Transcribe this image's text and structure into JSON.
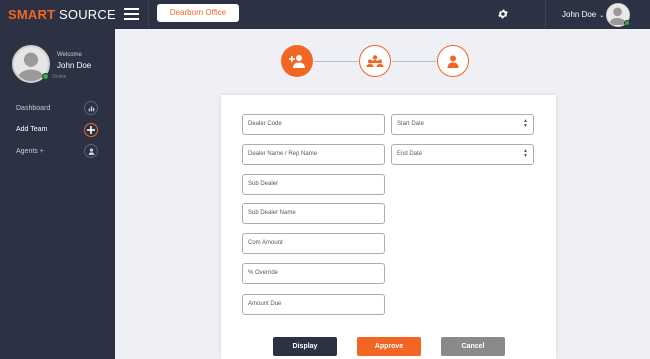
{
  "header": {
    "logo_part1": "SMART",
    "logo_part2": "SOURCE",
    "office_button": "Dearborn Office",
    "user_name": "John Doe",
    "user_chevron": "⌄"
  },
  "sidebar": {
    "welcome": "Welcome",
    "user_name": "John Doe",
    "status": "Online",
    "items": [
      {
        "label": "Dashboard",
        "icon": "chart-icon"
      },
      {
        "label": "Add Team",
        "icon": "plus-icon",
        "active": true
      },
      {
        "label": "Agents +",
        "icon": "user-icon"
      }
    ]
  },
  "stepper": {
    "steps": [
      {
        "icon": "add-user-icon",
        "state": "completed"
      },
      {
        "icon": "team-icon",
        "state": "pending"
      },
      {
        "icon": "user-icon",
        "state": "pending"
      }
    ]
  },
  "form": {
    "fields": {
      "dealer_code": "Dealer Code",
      "start_date": "Start Date",
      "dealer_name": "Dealer Name / Rep Name",
      "end_date": "End Date",
      "sub_dealer": "Sub Dealer",
      "sub_dealer_name": "Sub Dealer Name",
      "com_amount": "Com Amount",
      "override": "% Override",
      "amount_due": "Amount Due"
    },
    "buttons": {
      "display": "Display",
      "approve": "Approve",
      "cancel": "Cancel"
    }
  },
  "colors": {
    "accent": "#f26522",
    "navy": "#2c3143",
    "display_button": "#2c3143",
    "cancel_button": "#8a8a8a",
    "online": "#29b34a"
  }
}
